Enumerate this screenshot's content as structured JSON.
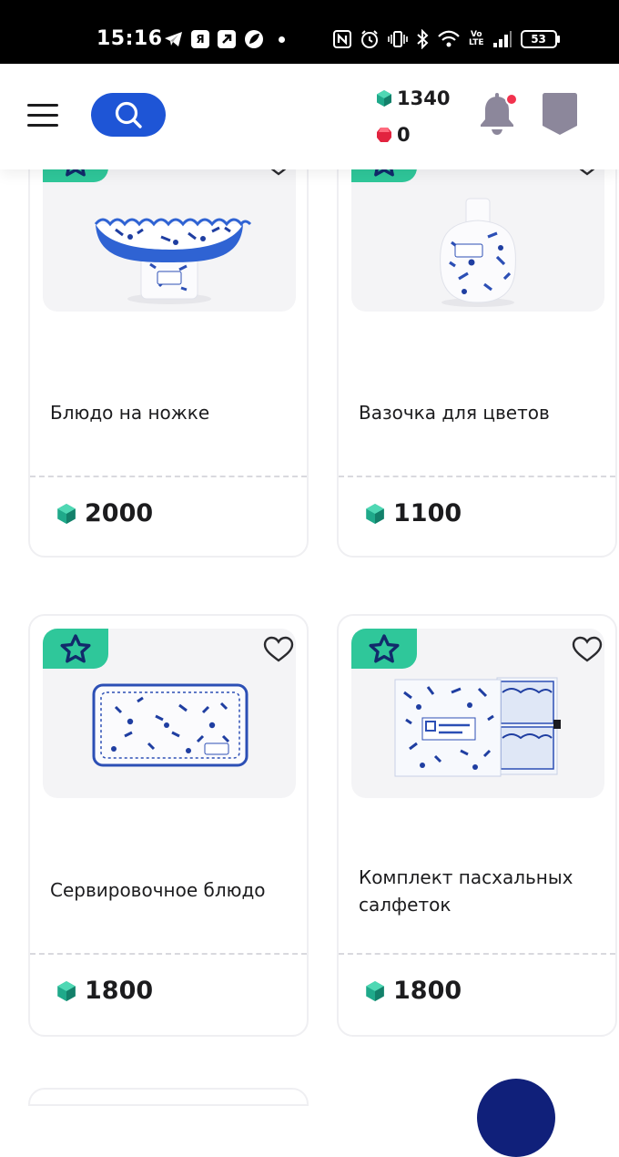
{
  "status_bar": {
    "time": "15:16",
    "battery": "53",
    "left_icons": [
      "telegram-icon",
      "yandex-icon",
      "arrow-app-icon",
      "leaf-app-icon",
      "dot-icon"
    ],
    "right_icons": [
      "nfc-icon",
      "alarm-icon",
      "vibrate-icon",
      "bluetooth-icon",
      "wifi-icon",
      "volte-icon",
      "signal-icon",
      "battery-icon"
    ],
    "volte_line1": "Vo",
    "volte_line2": "LTE",
    "sb_box_label": "Я"
  },
  "header": {
    "menu_icon": "hamburger-menu-icon",
    "search_icon": "search-icon",
    "search_color": "#1e55d6",
    "green_balance": "1340",
    "red_balance": "0",
    "notification_icon": "bell-icon",
    "notification_dot_color": "#f2324e",
    "profile_icon": "profile-shield-icon"
  },
  "colors": {
    "accent_green": "#2fc79a",
    "gem_green": "#1fa98a",
    "gem_red": "#e2233f",
    "text": "#1c1c1e"
  },
  "products": [
    {
      "title": "Блюдо на ножке",
      "price": "2000",
      "favorite_icon": "heart-outline-icon",
      "badge_icon": "star-icon"
    },
    {
      "title": "Вазочка для цветов",
      "price": "1100",
      "favorite_icon": "heart-outline-icon",
      "badge_icon": "star-icon"
    },
    {
      "title": "Сервировочное блюдо",
      "price": "1800",
      "favorite_icon": "heart-outline-icon",
      "badge_icon": "star-icon"
    },
    {
      "title": "Комплект пасхальных салфеток",
      "price": "1800",
      "favorite_icon": "heart-outline-icon",
      "badge_icon": "star-icon"
    }
  ]
}
